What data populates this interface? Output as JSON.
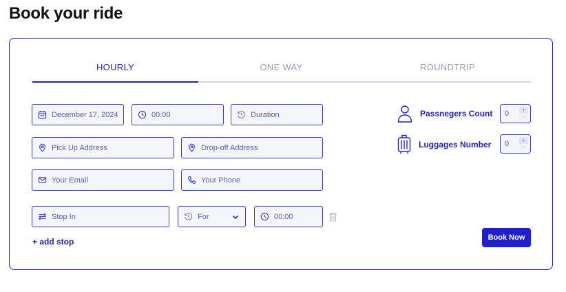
{
  "page": {
    "title": "Book your ride"
  },
  "tabs": [
    {
      "label": "HOURLY",
      "active": true
    },
    {
      "label": "ONE WAY",
      "active": false
    },
    {
      "label": "ROUNDTRIP",
      "active": false
    }
  ],
  "form": {
    "date": {
      "value": "December 17, 2024",
      "icon": "calendar-icon"
    },
    "time": {
      "value": "00:00",
      "icon": "clock-icon"
    },
    "duration": {
      "placeholder": "Duration",
      "icon": "history-icon"
    },
    "pickup": {
      "placeholder": "Pick Up Address",
      "icon": "map-pin-icon"
    },
    "dropoff": {
      "placeholder": "Drop-off Address",
      "icon": "map-pin-icon"
    },
    "email": {
      "placeholder": "Your Email",
      "icon": "mail-icon"
    },
    "phone": {
      "placeholder": "Your Phone",
      "icon": "phone-icon"
    },
    "stop_in": {
      "placeholder": "Stop In",
      "icon": "route-icon"
    },
    "stop_for": {
      "value": "For",
      "icon": "history-icon"
    },
    "stop_time": {
      "value": "00:00",
      "icon": "clock-icon"
    },
    "add_stop_label": "+ add stop",
    "book_label": "Book Now"
  },
  "counters": {
    "passengers": {
      "label": "Passnegers Count",
      "value": "0",
      "icon": "person-icon"
    },
    "luggages": {
      "label": "Luggages Number",
      "value": "0",
      "icon": "suitcase-icon"
    }
  },
  "colors": {
    "accent": "#1f1fbf",
    "button": "#1f1fce",
    "field_bg": "#f5f6fb",
    "muted": "#9b9bb8"
  }
}
